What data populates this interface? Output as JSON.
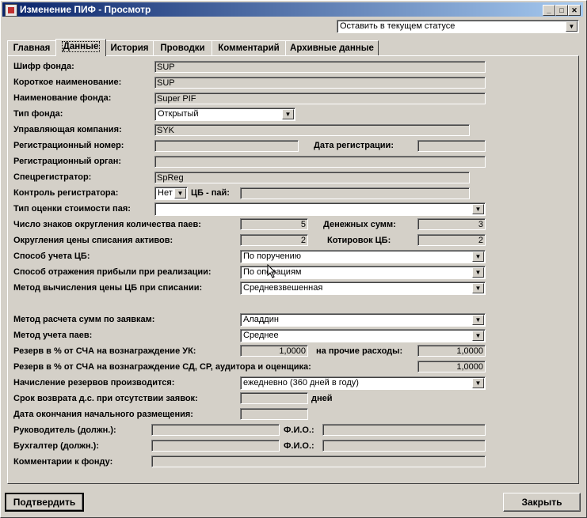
{
  "window": {
    "title": "Изменение ПИФ - Просмотр",
    "minimize": "_",
    "maximize": "□",
    "close": "✕"
  },
  "status_combo": {
    "value": "Оставить в текущем статусе"
  },
  "tabs": [
    "Главная",
    "Данные",
    "История",
    "Проводки",
    "Комментарий",
    "Архивные данные"
  ],
  "active_tab": "Данные",
  "form": {
    "fund_code": {
      "label": "Шифр фонда:",
      "value": "SUP"
    },
    "short_name": {
      "label": "Короткое наименование:",
      "value": "SUP"
    },
    "fund_name": {
      "label": "Наименование фонда:",
      "value": "Super PIF"
    },
    "fund_type": {
      "label": "Тип фонда:",
      "value": "Открытый"
    },
    "mgmt_company": {
      "label": "Управляющая компания:",
      "value": "SYK"
    },
    "reg_number": {
      "label": "Регистрационный номер:",
      "value": ""
    },
    "reg_date": {
      "label": "Дата регистрации:",
      "value": ""
    },
    "reg_body": {
      "label": "Регистрационный орган:",
      "value": ""
    },
    "spec_registrar": {
      "label": "Спецрегистратор:",
      "value": "SpReg"
    },
    "registrar_control": {
      "label": "Контроль регистратора:",
      "value": "Нет"
    },
    "cb_share": {
      "label": "ЦБ - пай:",
      "value": ""
    },
    "valuation_type": {
      "label": "Тип оценки стоимости пая:",
      "value": ""
    },
    "rounding_shares": {
      "label": "Число знаков округления количества паев:",
      "value": "5"
    },
    "money_sums": {
      "label": "Денежных сумм:",
      "value": "3"
    },
    "rounding_writeoff": {
      "label": "Округления цены списания активов:",
      "value": "2"
    },
    "cb_quotes": {
      "label": "Котировок ЦБ:",
      "value": "2"
    },
    "cb_accounting": {
      "label": "Способ учета ЦБ:",
      "value": "По поручению"
    },
    "profit_reflection": {
      "label": "Способ отражения прибыли при реализации:",
      "value": "По операциям"
    },
    "price_method": {
      "label": "Метод вычисления цены ЦБ при списании:",
      "value": "Средневзвешенная"
    },
    "order_calc": {
      "label": "Метод расчета сумм по заявкам:",
      "value": "Аладдин"
    },
    "share_accounting": {
      "label": "Метод учета паев:",
      "value": "Среднее"
    },
    "reserve_uk": {
      "label": "Резерв в % от СЧА на вознаграждение УК:",
      "value": "1,0000"
    },
    "other_expenses": {
      "label": "на прочие расходы:",
      "value": "1,0000"
    },
    "reserve_sd": {
      "label": "Резерв в % от СЧА на вознаграждение СД, СР, аудитора и оценщика:",
      "value": "1,0000"
    },
    "reserve_accrual": {
      "label": "Начисление резервов производится:",
      "value": "ежедневно (360 дней в году)"
    },
    "refund_term": {
      "label": "Срок возврата д.с. при отсутствии заявок:",
      "value": "",
      "unit": "дней"
    },
    "placement_end": {
      "label": "Дата окончания начального размещения:",
      "value": ""
    },
    "director": {
      "label": "Руководитель (должн.):",
      "value": "",
      "fio_label": "Ф.И.О.:",
      "fio_value": ""
    },
    "accountant": {
      "label": "Бухгалтер (должн.):",
      "value": "",
      "fio_label": "Ф.И.О.:",
      "fio_value": ""
    },
    "comments": {
      "label": "Комментарии к фонду:",
      "value": ""
    }
  },
  "buttons": {
    "confirm": "Подтвердить",
    "close": "Закрыть"
  }
}
